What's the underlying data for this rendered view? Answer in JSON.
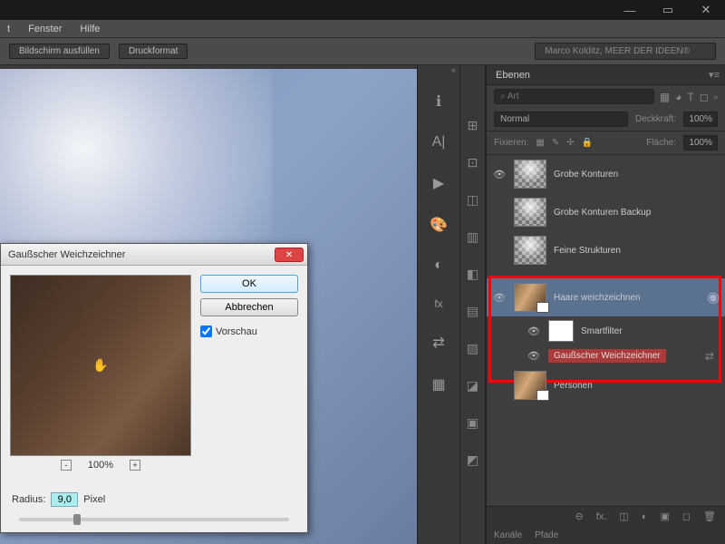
{
  "menubar": {
    "items": [
      "t",
      "Fenster",
      "Hilfe"
    ]
  },
  "winctrl": {
    "min": "—",
    "max": "▭",
    "close": "✕"
  },
  "toolbar": {
    "fullscreen": "Bildschirm ausfüllen",
    "printformat": "Druckformat",
    "profile": "Marco Kolditz, MEER DER IDEEN®"
  },
  "icons": {
    "info": "ℹ",
    "type": "A|",
    "play": "▶",
    "palette": "🎨",
    "adjust": "◐",
    "fx": "fx",
    "swap": "⇄",
    "grid": "▦",
    "arrow": "«"
  },
  "panelicons": [
    "⊞",
    "⊡",
    "◫",
    "▥",
    "◧",
    "▤",
    "▨",
    "◪",
    "▣",
    "◩"
  ],
  "layerspanel": {
    "title": "Ebenen",
    "search_placeholder": "⌕ Art",
    "ficons": [
      "▦",
      "◕",
      "T",
      "◻",
      "▫"
    ],
    "blend": {
      "mode": "Normal",
      "opacity_lbl": "Deckkraft:",
      "opacity": "100%"
    },
    "lock": {
      "label": "Fixieren:",
      "flaeche": "Fläche:",
      "flaeche_v": "100%",
      "icons": [
        "▦",
        "✎",
        "✢",
        "🔒"
      ]
    },
    "layers": [
      {
        "name": "Grobe Konturen"
      },
      {
        "name": "Grobe Konturen Backup"
      },
      {
        "name": "Feine Strukturen"
      },
      {
        "name": "Haare weichzeichnen",
        "sel": true
      },
      {
        "name": "Smartfilter",
        "sub": true
      },
      {
        "name": "Gaußscher Weichzeichner",
        "sf": true
      },
      {
        "name": "Personen"
      }
    ],
    "foot": [
      "⊖",
      "fx.",
      "◫",
      "◐",
      "▣",
      "◻",
      "🗑"
    ],
    "tabs2": [
      "Kanäle",
      "Pfade"
    ]
  },
  "dialog": {
    "title": "Gaußscher Weichzeichner",
    "ok": "OK",
    "cancel": "Abbrechen",
    "preview_lbl": "Vorschau",
    "zoom": "100%",
    "radius_lbl": "Radius:",
    "radius": "9,0",
    "unit": "Pixel",
    "close": "✕",
    "hand": "✋"
  }
}
